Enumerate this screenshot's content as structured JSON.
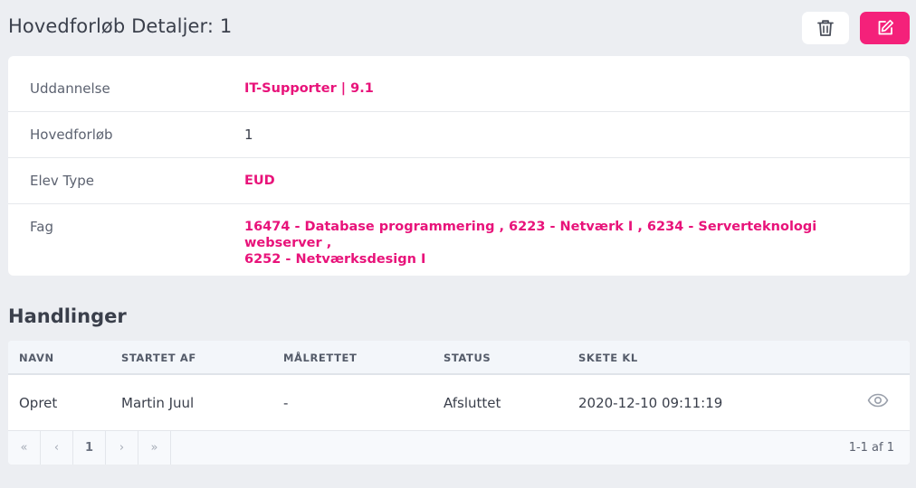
{
  "header": {
    "title": "Hovedforløb Detaljer: 1",
    "delete_icon": "trash-icon",
    "edit_icon": "edit-icon"
  },
  "details": {
    "rows": [
      {
        "label": "Uddannelse",
        "value": "IT-Supporter | 9.1",
        "accent": true
      },
      {
        "label": "Hovedforløb",
        "value": "1",
        "accent": false
      },
      {
        "label": "Elev Type",
        "value": "EUD",
        "accent": true
      },
      {
        "label": "Fag",
        "value_lines": [
          "16474 - Database programmering , 6223 - Netværk I , 6234 - Serverteknologi webserver ,",
          "6252 - Netværksdesign I"
        ],
        "accent": true
      }
    ]
  },
  "actions": {
    "title": "Handlinger",
    "columns": [
      "NAVN",
      "STARTET AF",
      "MÅLRETTET",
      "STATUS",
      "SKETE KL"
    ],
    "rows": [
      {
        "navn": "Opret",
        "startet_af": "Martin Juul",
        "maalrettet": "-",
        "status": "Afsluttet",
        "skete_kl": "2020-12-10 09:11:19",
        "icon": "eye-icon"
      }
    ],
    "pagination": {
      "first": "«",
      "prev": "‹",
      "page": "1",
      "next": "›",
      "last": "»",
      "info": "1-1 af 1"
    }
  },
  "colors": {
    "accent": "#f4217a",
    "accent_text": "#e8137a",
    "background": "#eceef2"
  }
}
